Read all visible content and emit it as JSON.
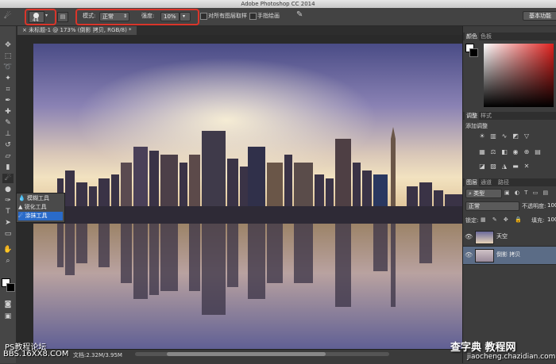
{
  "app": {
    "title": "Adobe Photoshop CC 2014"
  },
  "options": {
    "brush_size": "44",
    "mode_label": "模式:",
    "mode_value": "正常",
    "strength_label": "强度:",
    "strength_value": "10%",
    "sample_all_label": "对所有图层取样",
    "finger_paint_label": "手指绘画",
    "workspace_button": "基本功能"
  },
  "document": {
    "tab_label": "未标题-1 @ 173% (倒影 拷贝, RGB/8) *"
  },
  "flyout": {
    "items": [
      {
        "label": "模糊工具",
        "selected": false
      },
      {
        "label": "锐化工具",
        "selected": false
      },
      {
        "label": "涂抹工具",
        "selected": true
      }
    ]
  },
  "status": {
    "doc_info": "文档:2.32M/3.95M"
  },
  "panels": {
    "color_tabs": [
      "颜色",
      "色板"
    ],
    "adjust_tabs": [
      "调整",
      "样式"
    ],
    "adjust_add": "添加调整",
    "layer_tabs": [
      "图层",
      "通道",
      "路径"
    ],
    "filter_kind": "类型",
    "blend_mode": "正常",
    "opacity_label": "不透明度:",
    "opacity_value": "100",
    "lock_label": "锁定:",
    "fill_label": "填充:",
    "fill_value": "100",
    "layers": [
      {
        "name": "天空",
        "selected": false
      },
      {
        "name": "倒影 拷贝",
        "selected": true
      }
    ]
  },
  "watermarks": {
    "left_top": "PS教程论坛",
    "left_bottom": "BBS.16XX8.COM",
    "right_top": "查字典 教程网",
    "right_bottom": "jiaocheng.chazidian.com"
  },
  "colors": {
    "accent_red": "#d9352a",
    "selection_blue": "#2a6bc9"
  }
}
